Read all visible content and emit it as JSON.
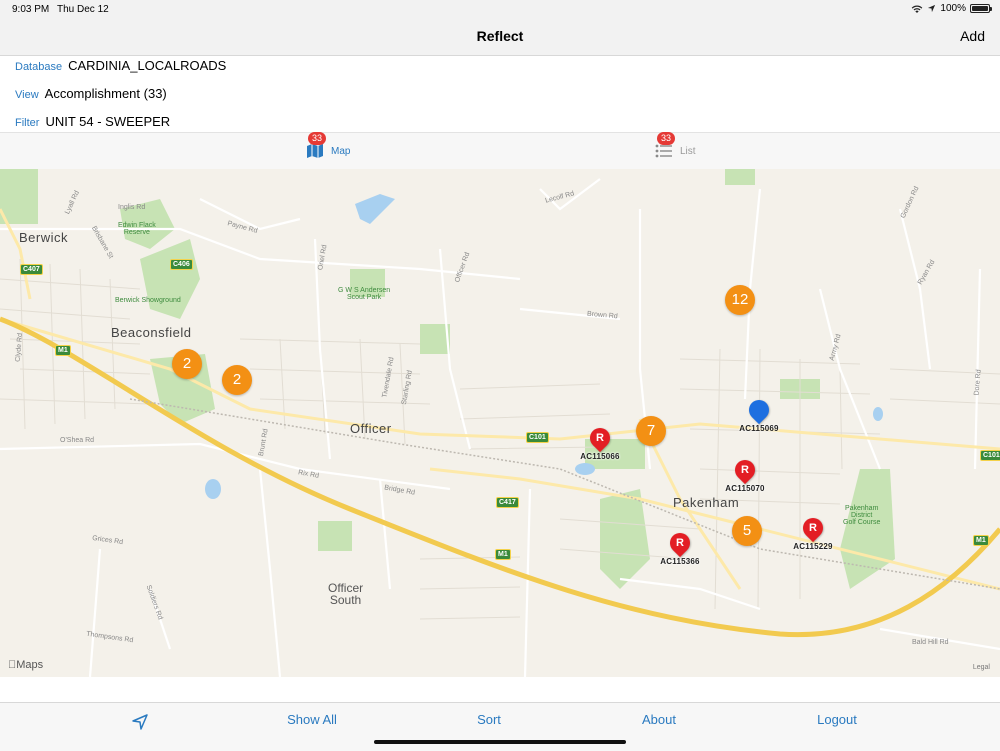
{
  "status": {
    "time": "9:03 PM",
    "date": "Thu Dec 12",
    "battery": "100%"
  },
  "nav": {
    "title": "Reflect",
    "add": "Add"
  },
  "info": {
    "database": {
      "label": "Database",
      "value": "CARDINIA_LOCALROADS"
    },
    "view": {
      "label": "View",
      "value": "Accomplishment (33)"
    },
    "filter": {
      "label": "Filter",
      "value": "UNIT 54 - SWEEPER"
    }
  },
  "segments": {
    "map": {
      "label": "Map",
      "badge": "33"
    },
    "list": {
      "label": "List",
      "badge": "33"
    }
  },
  "map": {
    "places": {
      "berwick": "Berwick",
      "beaconsfield": "Beaconsfield",
      "officer": "Officer",
      "officer_south": "Officer\nSouth",
      "pakenham": "Pakenham"
    },
    "parks": {
      "edwin": "Edwin Flack\nReserve",
      "showground": "Berwick Showground",
      "gws": "G W S Andersen\nScout Park",
      "golf": "Pakenham\nDistrict\nGolf Course"
    },
    "roads": {
      "inglis": "Inglis Rd",
      "lysterfield": "Lyall Rd",
      "brisbane": "Brisbane St",
      "payne": "Payne Rd",
      "officer": "Officer Rd",
      "lecoln": "Lecolf Rd",
      "brown": "Brown Rd",
      "army": "Army Rd",
      "gordon": "Gordon Rd",
      "ryan": "Ryan Rd",
      "dore": "Dore Rd",
      "bald": "Bald Hill Rd",
      "oshea": "O'Shea Rd",
      "rix": "Rix Rd",
      "bridge": "Bridge Rd",
      "grices": "Grices Rd",
      "thompsons": "Thompsons Rd",
      "soldiers": "Soldiers Rd",
      "tivendale": "Tivendale Rd",
      "stalling": "Starling Rd",
      "brunt": "Brunt Rd",
      "crisp": "Cardinia Rd",
      "clyde": "Clyde Rd",
      "oriel": "Oriel Rd"
    },
    "shields": {
      "c407": "C407",
      "c406": "C406",
      "m1a": "M1",
      "m1b": "M1",
      "m1c": "M1",
      "c101a": "C101",
      "c101b": "C101",
      "c417": "C417"
    },
    "clusters": {
      "c1": "2",
      "c2": "2",
      "c3": "12",
      "c4": "7",
      "c5": "5"
    },
    "pins": {
      "p1": {
        "letter": "R",
        "label": "AC115066"
      },
      "p2": {
        "letter": "",
        "label": "AC115069"
      },
      "p3": {
        "letter": "R",
        "label": "AC115070"
      },
      "p4": {
        "letter": "R",
        "label": "AC115366"
      },
      "p5": {
        "letter": "R",
        "label": "AC115229"
      }
    },
    "logo": "Maps",
    "legal": "Legal"
  },
  "tabbar": {
    "show_all": "Show All",
    "sort": "Sort",
    "about": "About",
    "logout": "Logout"
  },
  "colors": {
    "accent": "#2a7ac0",
    "cluster": "#f39014",
    "pin_red": "#e31e24",
    "pin_blue": "#1e6fe0",
    "badge": "#e53935"
  }
}
